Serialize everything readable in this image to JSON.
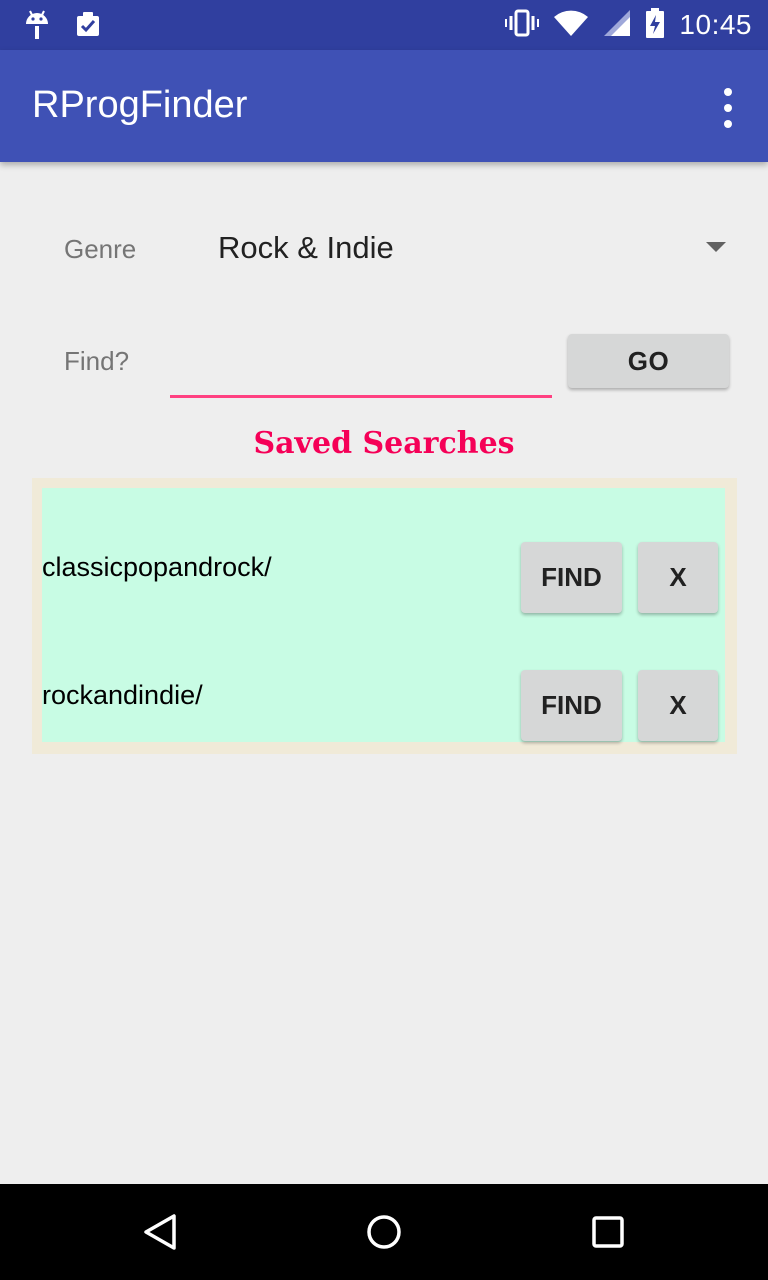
{
  "status_bar": {
    "time": "10:45",
    "left_icons": [
      "android-debug-icon",
      "clipboard-check-icon"
    ],
    "right_icons": [
      "vibrate-icon",
      "wifi-icon",
      "cell-signal-icon",
      "battery-charging-icon"
    ]
  },
  "app_bar": {
    "title": "RProgFinder",
    "overflow_icon": "more-vert-icon"
  },
  "form": {
    "genre_label": "Genre",
    "genre_value": "Rock & Indie",
    "find_label": "Find?",
    "find_value": "",
    "go_label": "GO"
  },
  "saved": {
    "heading": "Saved Searches",
    "items": [
      {
        "name": "classicpopandrock/",
        "find_label": "FIND",
        "remove_label": "X"
      },
      {
        "name": "rockandindie/",
        "find_label": "FIND",
        "remove_label": "X"
      }
    ]
  },
  "nav_bar": {
    "icons": [
      "back-icon",
      "home-icon",
      "recents-icon"
    ]
  },
  "colors": {
    "status_bar": "#303f9f",
    "app_bar": "#3f51b5",
    "accent": "#ff4081",
    "heading": "#f50057",
    "list_border": "#f0ead8",
    "list_bg": "#c8fce4",
    "background": "#eeeeee"
  }
}
